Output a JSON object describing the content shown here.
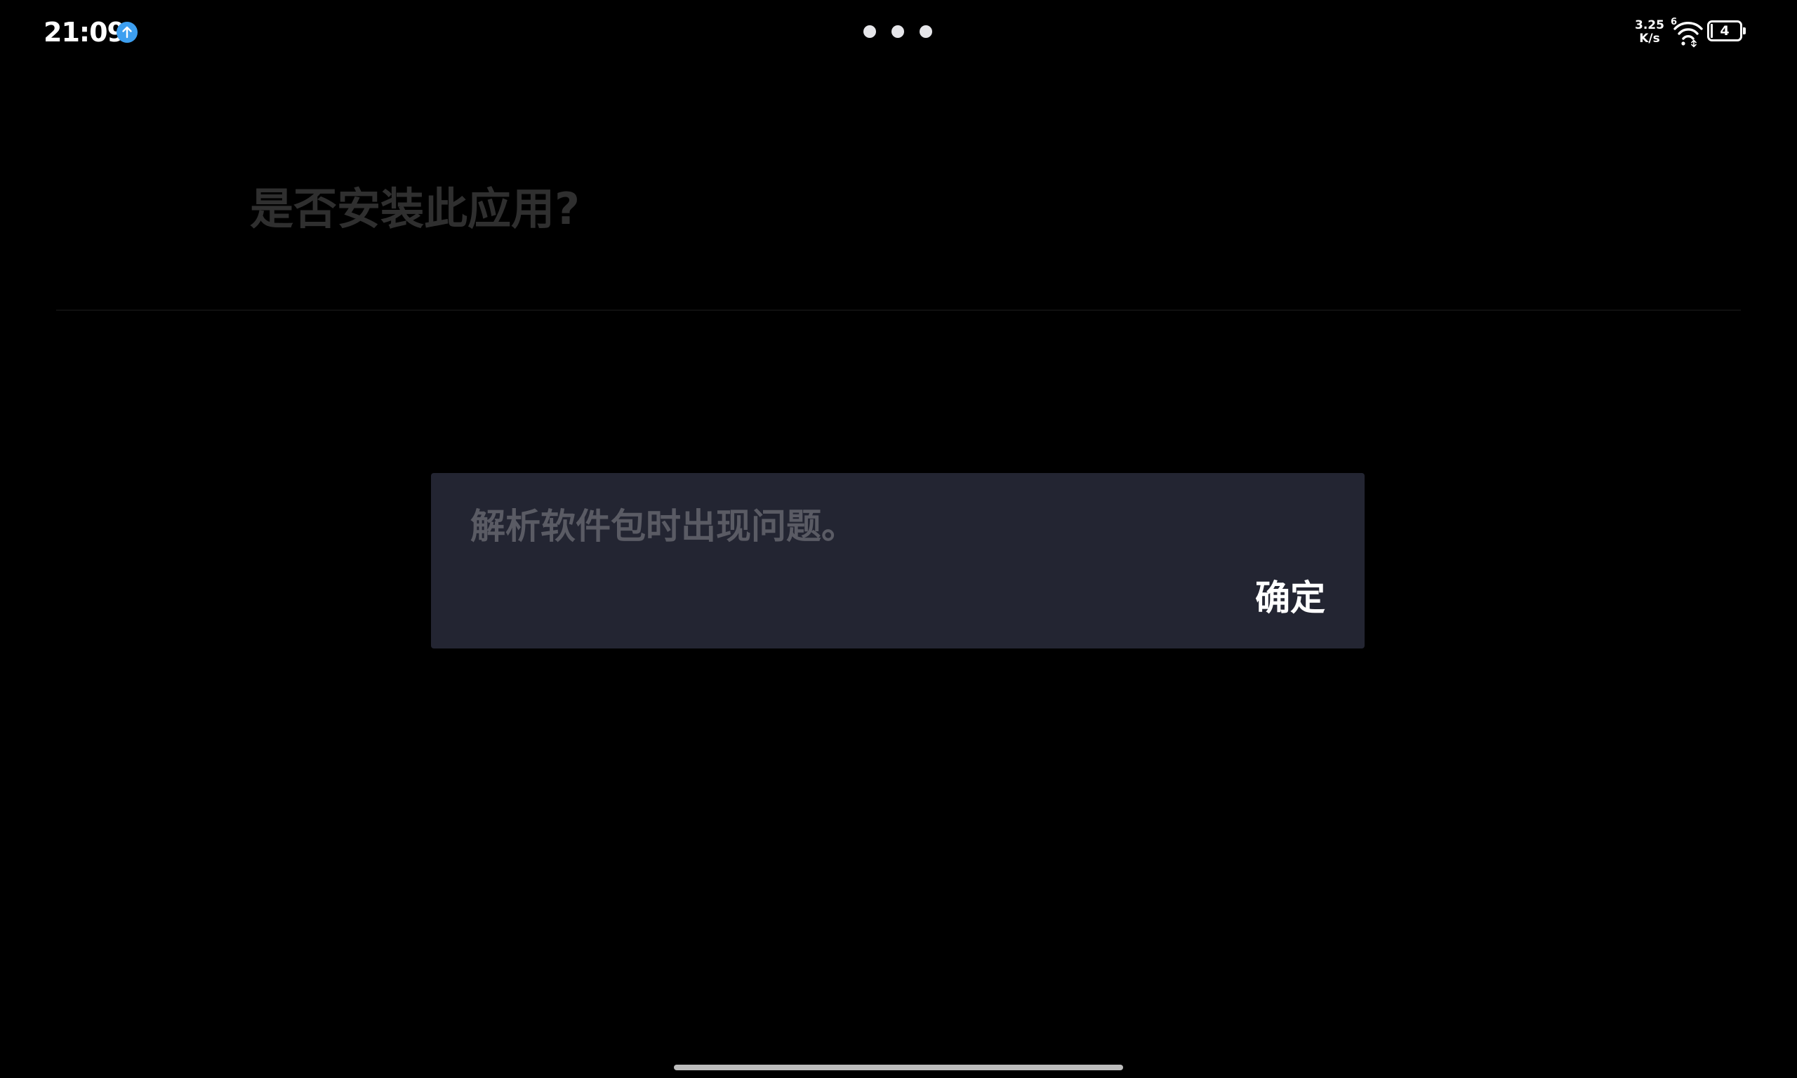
{
  "status_bar": {
    "time": "21:09",
    "notification_icon": "upload-arrow-icon",
    "notification_color": "#3d9ff0",
    "dots_icon": "three-dots-icon",
    "net_speed_value": "3.25",
    "net_speed_unit": "K/s",
    "wifi_icon": "wifi-6-icon",
    "wifi_label": "6",
    "battery_icon": "battery-icon",
    "battery_level": "4"
  },
  "install_page": {
    "title": "是否安装此应用?"
  },
  "dialog": {
    "message": "解析软件包时出现问题。",
    "ok_label": "确定",
    "background_color": "#232532"
  },
  "navigation": {
    "gesture_handle_icon": "gesture-bar-icon"
  }
}
